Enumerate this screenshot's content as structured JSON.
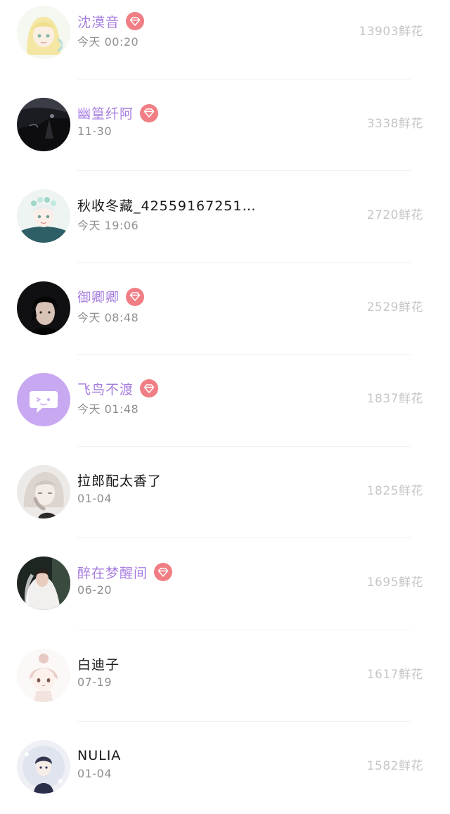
{
  "rankings": [
    {
      "name": "沈漠音",
      "time": "今天 00:20",
      "flowers": "13903鲜花",
      "vip": true,
      "avatar_icon": "anime-girl-blonde-avatar"
    },
    {
      "name": "幽篁纤阿",
      "time": "11-30",
      "flowers": "3338鲜花",
      "vip": true,
      "avatar_icon": "dark-landscape-avatar"
    },
    {
      "name": "秋收冬藏_42559167251…",
      "time": "今天 19:06",
      "flowers": "2720鲜花",
      "vip": false,
      "avatar_icon": "anime-boy-flower-crown-avatar"
    },
    {
      "name": "御卿卿",
      "time": "今天 08:48",
      "flowers": "2529鲜花",
      "vip": true,
      "avatar_icon": "dark-haired-man-avatar"
    },
    {
      "name": "飞鸟不渡",
      "time": "今天 01:48",
      "flowers": "1837鲜花",
      "vip": true,
      "avatar_icon": "default-chat-bubble-avatar"
    },
    {
      "name": "拉郎配太香了",
      "time": "01-04",
      "flowers": "1825鲜花",
      "vip": false,
      "avatar_icon": "sketch-character-avatar"
    },
    {
      "name": "醉在梦醒间",
      "time": "06-20",
      "flowers": "1695鲜花",
      "vip": true,
      "avatar_icon": "bride-photo-avatar"
    },
    {
      "name": "白迪子",
      "time": "07-19",
      "flowers": "1617鲜花",
      "vip": false,
      "avatar_icon": "chibi-girl-avatar"
    },
    {
      "name": "NULIA",
      "time": "01-04",
      "flowers": "1582鲜花",
      "vip": false,
      "avatar_icon": "anime-figure-avatar"
    }
  ],
  "colors": {
    "vip_name": "#a77ee0",
    "vip_badge": "#f07e84",
    "default_avatar": "#c9a8f2",
    "flower_count": "#c6c6c6",
    "time": "#8f8f8f"
  }
}
